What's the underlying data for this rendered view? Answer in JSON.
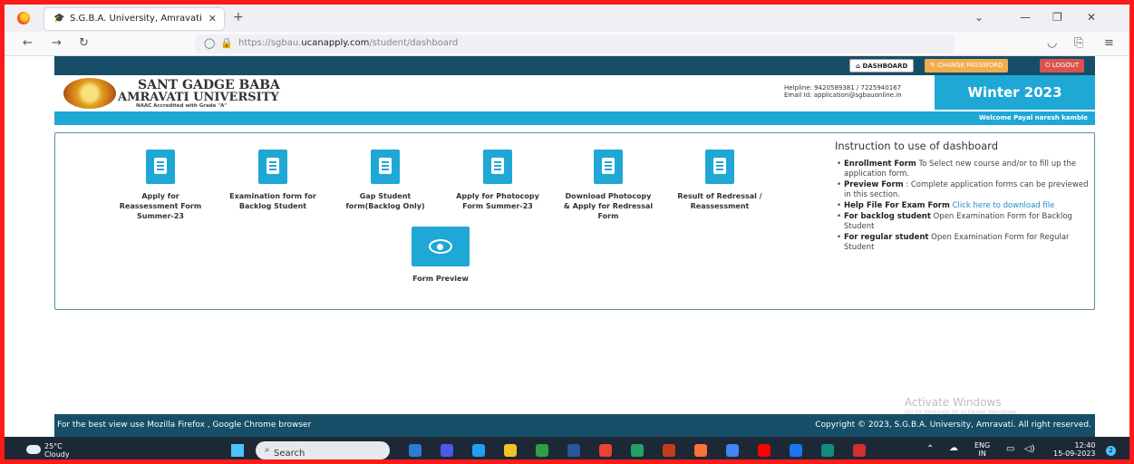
{
  "browser": {
    "tab_title": "S.G.B.A. University, Amravati",
    "url_prefix": "https://sgbau.",
    "url_domain": "ucanapply.com",
    "url_path": "/student/dashboard"
  },
  "topnav": {
    "dashboard": "DASHBOARD",
    "change_password": "CHANGE PASSWORD",
    "logout": "LOGOUT"
  },
  "header": {
    "univ_line1": "SANT GADGE BABA",
    "univ_line2": "AMRAVATI UNIVERSITY",
    "accreditation": "NAAC Accredited with Grade \"A\"",
    "helpline": "Helpline: 9420589381 / 7225940167",
    "email": "Email Id: application@sgbauonline.in",
    "session": "Winter 2023",
    "welcome": "Welcome Payal naresh kamble"
  },
  "tiles": [
    {
      "label": "Apply for Reassessment Form Summer-23"
    },
    {
      "label": "Examination form for Backlog Student"
    },
    {
      "label": "Gap Student form(Backlog Only)"
    },
    {
      "label": "Apply for Photocopy Form Summer-23"
    },
    {
      "label": "Download Photocopy & Apply for Redressal Form"
    },
    {
      "label": "Result of Redressal / Reassessment"
    },
    {
      "label": "Form Preview"
    }
  ],
  "instructions": {
    "title": "Instruction to use of dashboard",
    "items": [
      {
        "bold": "Enrollment Form",
        "text": " To Select new course and/or to fill up the application form."
      },
      {
        "bold": "Preview Form",
        "text": " : Complete application forms can be previewed in this section."
      },
      {
        "bold": "Help File For Exam Form",
        "link": " Click here to download file"
      },
      {
        "bold": "For backlog student",
        "text": " Open Examination Form for Backlog Student"
      },
      {
        "bold": "For regular student",
        "text": " Open Examination Form for Regular Student"
      }
    ]
  },
  "watermark": {
    "title": "Activate Windows",
    "sub": "Go to Settings to activate Windows."
  },
  "footer": {
    "left": "For the best view use Mozilla Firefox , Google Chrome browser",
    "right": "Copyright © 2023, S.G.B.A. University, Amravati. All right reserved."
  },
  "taskbar": {
    "temp": "25°C",
    "weather": "Cloudy",
    "search": "Search",
    "lang1": "ENG",
    "lang2": "IN",
    "time": "12:40",
    "date": "15-09-2023",
    "notif_count": "2",
    "apps": [
      "#2b7cd3",
      "#4b5ae8",
      "#1ea1f1",
      "#f3c326",
      "#2f9e44",
      "#2b579a",
      "#ea4335",
      "#21a366",
      "#c43e1c",
      "#ff7139",
      "#4285f4",
      "#ff0000",
      "#1877f2",
      "#128c7e",
      "#d32f2f"
    ]
  }
}
